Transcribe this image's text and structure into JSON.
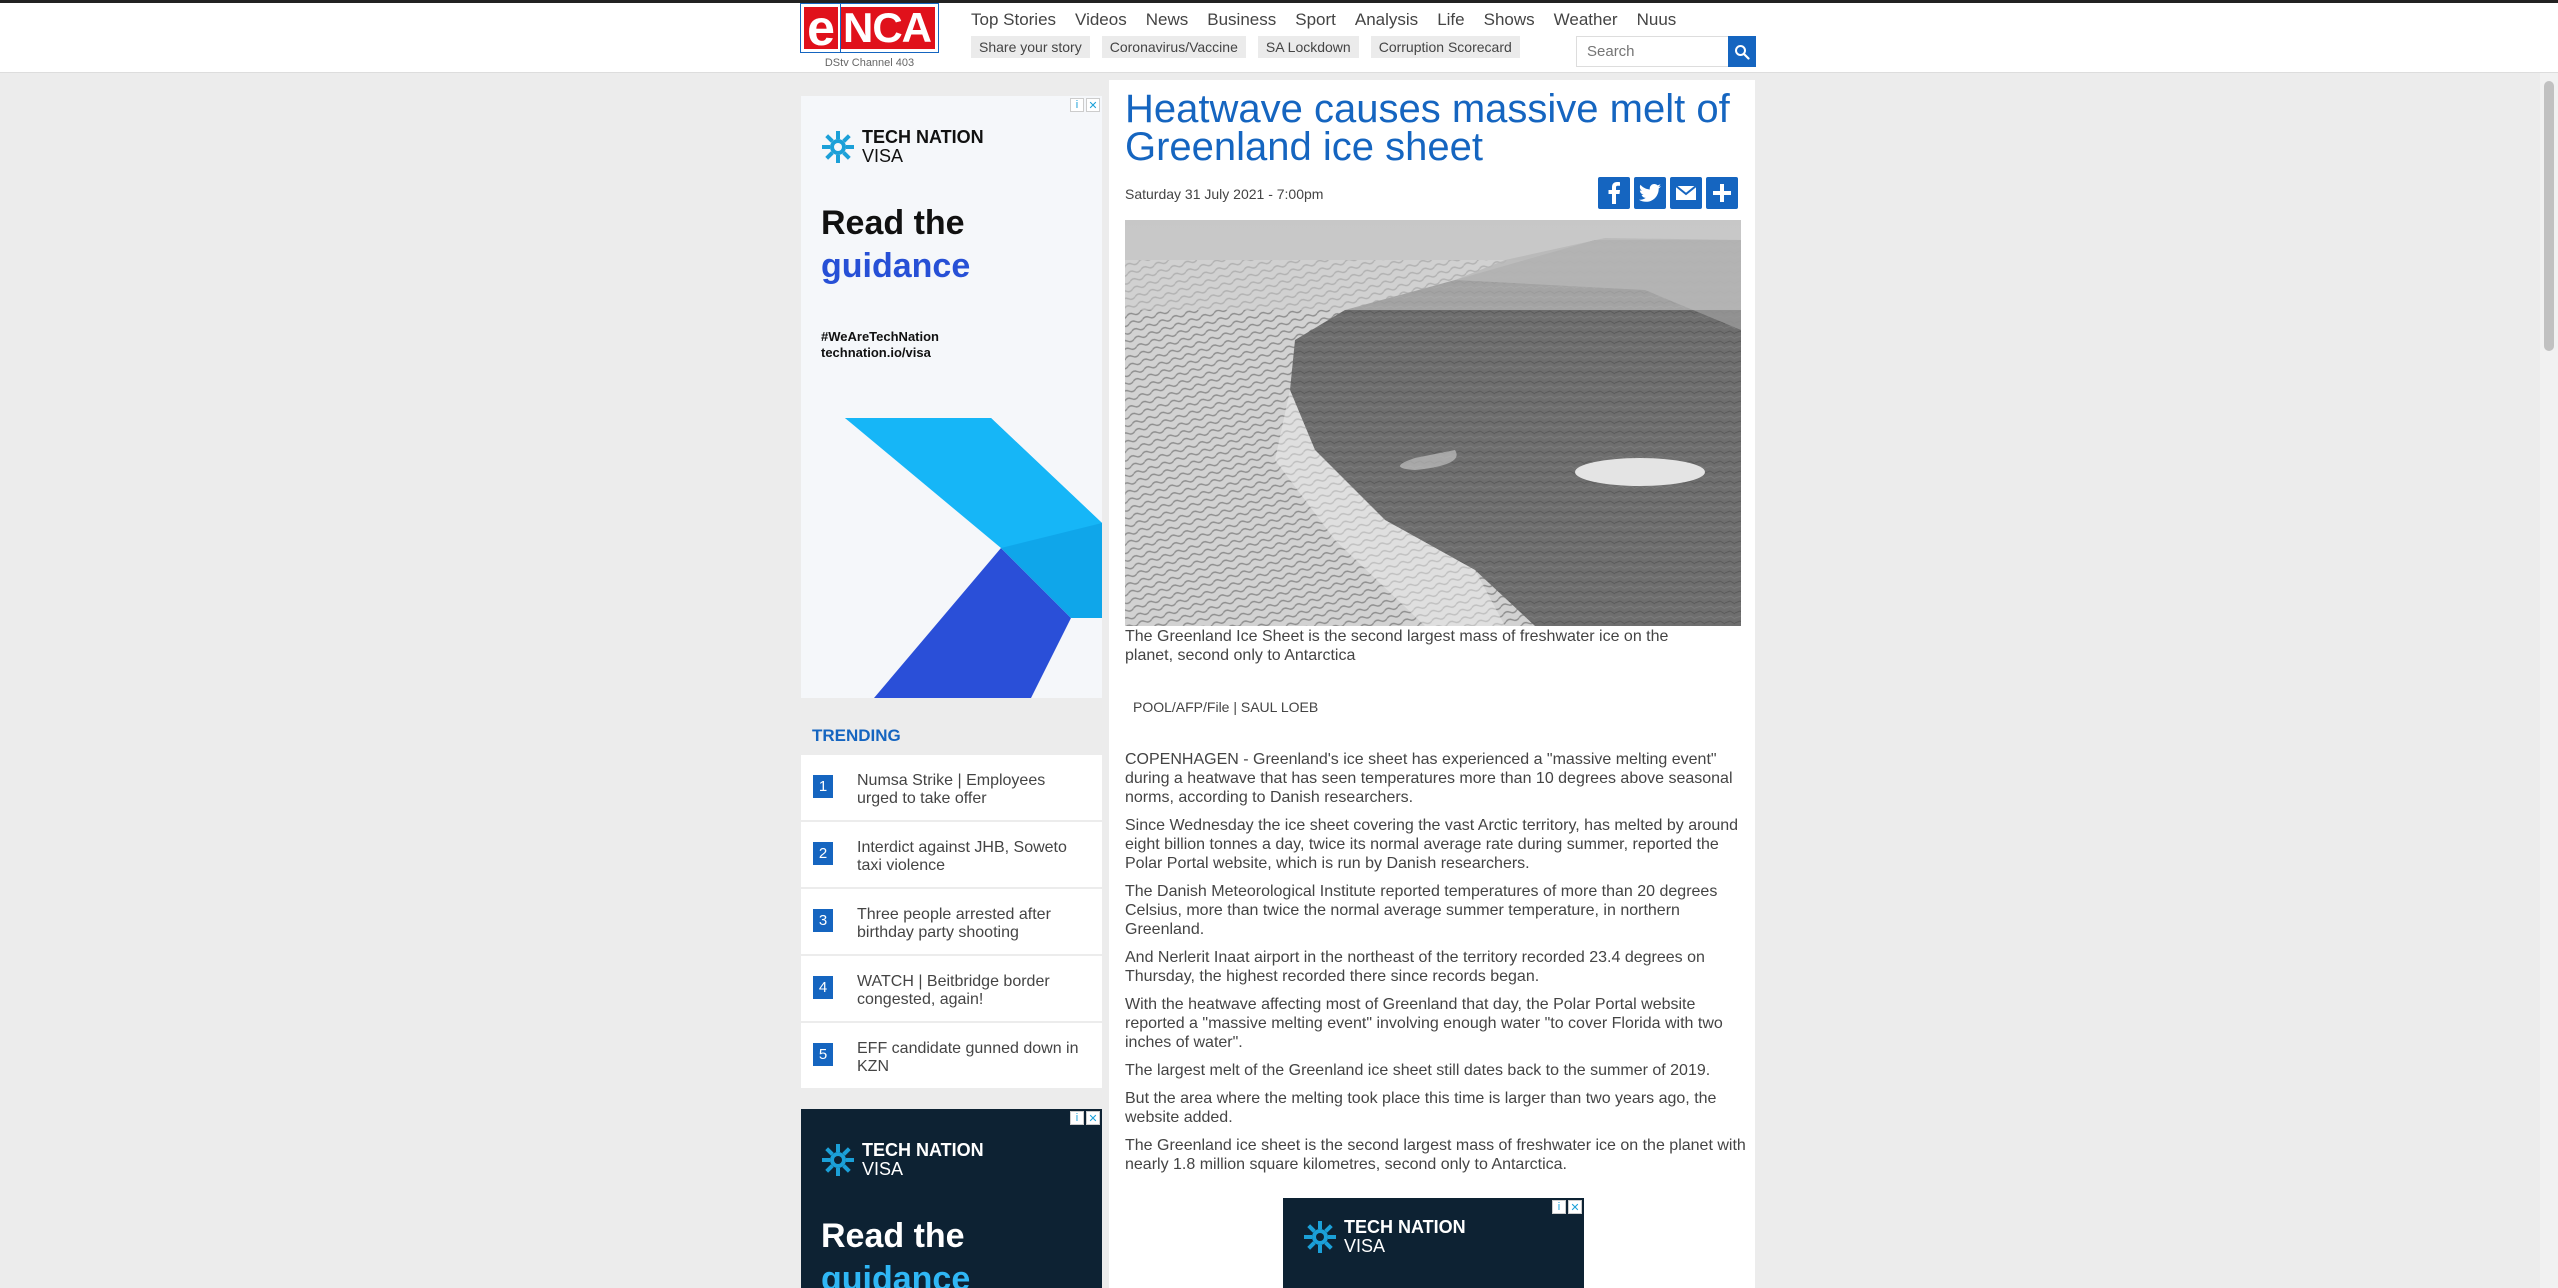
{
  "brand": {
    "logo_e": "e",
    "logo_nca": "NCA",
    "channel": "DStv Channel 403"
  },
  "nav": [
    "Top Stories",
    "Videos",
    "News",
    "Business",
    "Sport",
    "Analysis",
    "Life",
    "Shows",
    "Weather",
    "Nuus"
  ],
  "subnav": [
    "Share your story",
    "Coronavirus/Vaccine",
    "SA Lockdown",
    "Corruption Scorecard"
  ],
  "search": {
    "placeholder": "Search"
  },
  "ads": {
    "brand_line1": "TECH NATION",
    "brand_line2": "VISA",
    "headline_line1": "Read the",
    "headline_line2": "guidance",
    "hashtag": "#WeAreTechNation",
    "url": "technation.io/visa"
  },
  "trending": {
    "title": "TRENDING",
    "items": [
      {
        "num": "1",
        "title": "Numsa Strike | Employees urged to take offer"
      },
      {
        "num": "2",
        "title": "Interdict against JHB, Soweto taxi violence"
      },
      {
        "num": "3",
        "title": "Three people arrested after birthday party shooting"
      },
      {
        "num": "4",
        "title": "WATCH | Beitbridge border congested, again!"
      },
      {
        "num": "5",
        "title": "EFF candidate gunned down in KZN"
      }
    ]
  },
  "article": {
    "headline": "Heatwave causes massive melt of Greenland ice sheet",
    "date": "Saturday 31 July 2021 - 7:00pm",
    "caption": "The Greenland Ice Sheet is the second largest mass of freshwater ice on the planet, second only to Antarctica",
    "credit": "POOL/AFP/File | SAUL LOEB",
    "paragraphs": [
      "COPENHAGEN - Greenland's ice sheet has experienced a \"massive melting event\" during a heatwave that has seen temperatures more than 10 degrees above seasonal norms, according to Danish researchers.",
      "Since Wednesday the ice sheet covering the vast Arctic territory, has melted by around eight billion tonnes a day, twice its normal average rate during summer, reported the Polar Portal website, which is run by Danish researchers.",
      "The Danish Meteorological Institute reported temperatures of more than 20 degrees Celsius, more than twice the normal average summer temperature, in northern Greenland.",
      "And Nerlerit Inaat airport in the northeast of the territory recorded 23.4 degrees on Thursday, the highest recorded there since records began.",
      "With the heatwave affecting most of Greenland that day, the Polar Portal website reported a \"massive melting event\" involving enough water \"to cover Florida with two inches of water\".",
      "The largest melt of the Greenland ice sheet still dates back to the summer of 2019.",
      "But the area where the melting took place this time is larger than two years ago, the website added.",
      "The Greenland ice sheet is the second largest mass of freshwater ice on the planet with nearly 1.8 million square kilometres, second only to Antarctica."
    ]
  },
  "colors": {
    "brand_red": "#e0111b",
    "accent_blue": "#1565c0"
  },
  "icons": [
    "search-icon",
    "facebook-icon",
    "twitter-icon",
    "email-icon",
    "plus-share-icon",
    "adchoices-icon",
    "close-icon"
  ]
}
